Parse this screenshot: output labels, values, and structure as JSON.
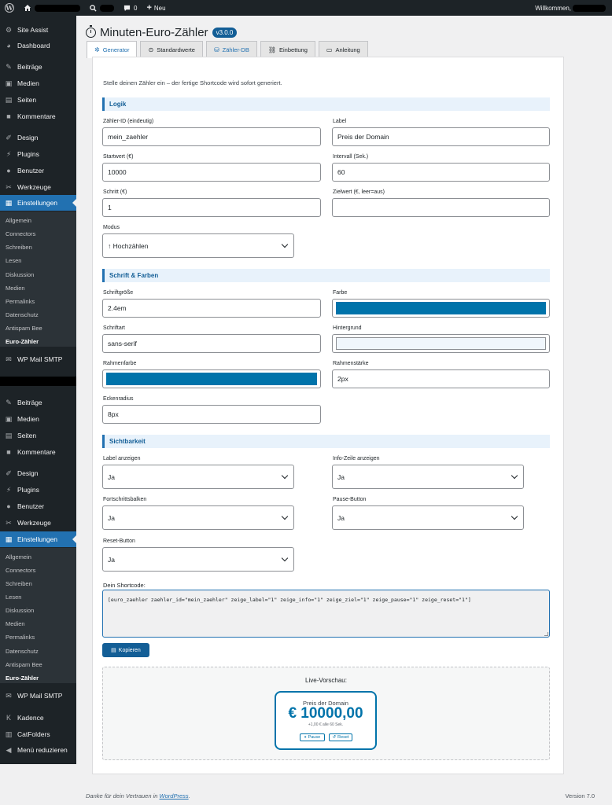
{
  "adminbar": {
    "new_count": "0",
    "new_label": "Neu",
    "greeting": "Willkommen,"
  },
  "sidebar": {
    "top_items": [
      {
        "label": "Site Assist",
        "icon": "gear-icon"
      },
      {
        "label": "Dashboard",
        "icon": "dashboard-icon"
      },
      {
        "label": "Beiträge",
        "icon": "pin-icon"
      },
      {
        "label": "Medien",
        "icon": "media-icon"
      },
      {
        "label": "Seiten",
        "icon": "pages-icon"
      },
      {
        "label": "Kommentare",
        "icon": "comment-icon"
      },
      {
        "label": "Design",
        "icon": "brush-icon"
      },
      {
        "label": "Plugins",
        "icon": "plugin-icon"
      },
      {
        "label": "Benutzer",
        "icon": "user-icon"
      },
      {
        "label": "Werkzeuge",
        "icon": "wrench-icon"
      },
      {
        "label": "Einstellungen",
        "icon": "settings-icon"
      }
    ],
    "sub_items": [
      "Allgemein",
      "Connectors",
      "Schreiben",
      "Lesen",
      "Diskussion",
      "Medien",
      "Permalinks",
      "Datenschutz",
      "Antispam Bee",
      "Euro-Zähler"
    ],
    "smtp": "WP Mail SMTP",
    "bottom_items": [
      {
        "label": "Beiträge",
        "icon": "pin-icon"
      },
      {
        "label": "Medien",
        "icon": "media-icon"
      },
      {
        "label": "Seiten",
        "icon": "pages-icon"
      },
      {
        "label": "Kommentare",
        "icon": "comment-icon"
      },
      {
        "label": "Design",
        "icon": "brush-icon"
      },
      {
        "label": "Plugins",
        "icon": "plugin-icon"
      },
      {
        "label": "Benutzer",
        "icon": "user-icon"
      },
      {
        "label": "Werkzeuge",
        "icon": "wrench-icon"
      },
      {
        "label": "Einstellungen",
        "icon": "settings-icon"
      }
    ],
    "sub_items_2": [
      "Allgemein",
      "Connectors",
      "Schreiben",
      "Lesen",
      "Diskussion",
      "Medien",
      "Permalinks",
      "Datenschutz",
      "Antispam Bee",
      "Euro-Zähler"
    ],
    "smtp_2": "WP Mail SMTP",
    "extra_items": [
      {
        "label": "Kadence",
        "icon": "kadence-icon"
      },
      {
        "label": "CatFolders",
        "icon": "folder-icon"
      },
      {
        "label": "Menü reduzieren",
        "icon": "collapse-icon"
      }
    ]
  },
  "page": {
    "title": "Minuten-Euro-Zähler",
    "version": "v3.0.0",
    "tabs": [
      {
        "label": "Generator",
        "icon": "generator-icon"
      },
      {
        "label": "Standardwerte",
        "icon": "defaults-icon"
      },
      {
        "label": "Zähler-DB",
        "icon": "database-icon"
      },
      {
        "label": "Einbettung",
        "icon": "link-icon"
      },
      {
        "label": "Anleitung",
        "icon": "guide-icon"
      }
    ],
    "intro": "Stelle deinen Zähler ein – der fertige Shortcode wird sofort generiert."
  },
  "sections": {
    "logik": "Logik",
    "schrift": "Schrift & Farben",
    "sicht": "Sichtbarkeit"
  },
  "form": {
    "zaehler_id": {
      "label": "Zähler-ID (eindeutig)",
      "value": "mein_zaehler"
    },
    "label": {
      "label": "Label",
      "value": "Preis der Domain"
    },
    "startwert": {
      "label": "Startwert (€)",
      "value": "10000"
    },
    "intervall": {
      "label": "Intervall (Sek.)",
      "value": "60"
    },
    "schritt": {
      "label": "Schritt (€)",
      "value": "1"
    },
    "zielwert": {
      "label": "Zielwert (€, leer=aus)",
      "value": ""
    },
    "modus": {
      "label": "Modus",
      "value": "↑ Hochzählen"
    },
    "schriftgroesse": {
      "label": "Schriftgröße",
      "value": "2.4em"
    },
    "farbe": {
      "label": "Farbe",
      "value": "#0073aa"
    },
    "schriftart": {
      "label": "Schriftart",
      "value": "sans-serif"
    },
    "hintergrund": {
      "label": "Hintergrund",
      "value": "#f0f6fc"
    },
    "rahmenfarbe": {
      "label": "Rahmenfarbe",
      "value": "#0073aa"
    },
    "rahmenstaerke": {
      "label": "Rahmenstärke",
      "value": "2px"
    },
    "eckenradius": {
      "label": "Eckenradius",
      "value": "8px"
    },
    "label_anzeigen": {
      "label": "Label anzeigen",
      "value": "Ja"
    },
    "info_zeile": {
      "label": "Info-Zeile anzeigen",
      "value": "Ja"
    },
    "fortschritt": {
      "label": "Fortschrittsbalken",
      "value": "Ja"
    },
    "pause_button": {
      "label": "Pause-Button",
      "value": "Ja"
    },
    "reset_button": {
      "label": "Reset-Button",
      "value": "Ja"
    }
  },
  "shortcode": {
    "label": "Dein Shortcode:",
    "value": "[euro_zaehler zaehler_id=\"mein_zaehler\" zeige_label=\"1\" zeige_info=\"1\" zeige_ziel=\"1\" zeige_pause=\"1\" zeige_reset=\"1\"]",
    "copy_label": "Kopieren"
  },
  "preview": {
    "title": "Live-Vorschau:",
    "label": "Preis der Domain",
    "value": "€ 10000,00",
    "info": "+1,00 € alle 60 Sek.",
    "pause": "Pause",
    "reset": "Reset"
  },
  "footer": {
    "text_before": "Danke für dein Vertrauen in ",
    "link": "WordPress",
    "text_after": ".",
    "version": "Version 7.0"
  },
  "colors": {
    "accent": "#2271b1",
    "counter_blue": "#0073aa",
    "admin_dark": "#1d2327"
  }
}
